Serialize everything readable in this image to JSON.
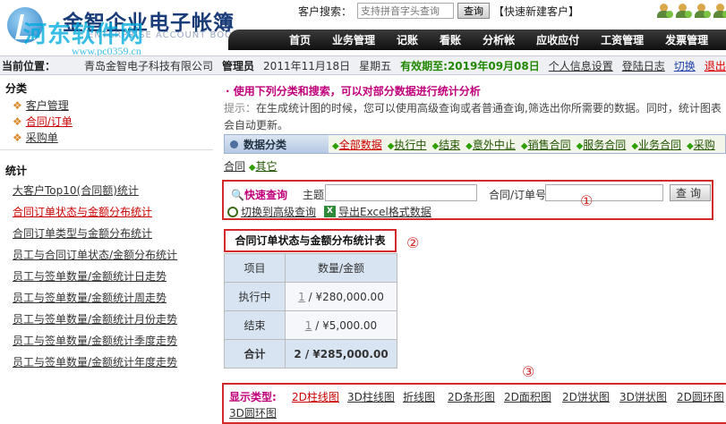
{
  "header": {
    "logo_title": "金智企业电子帐簿",
    "logo_sub": "ENTERPRISE ACCOUNT BOOK",
    "watermark": "河东软件网",
    "watermark_url": "www.pc0359.cn",
    "search_label": "客户搜索：",
    "search_placeholder": "支持拼音字头查询",
    "search_button": "查询",
    "new_customer": "【快速新建客户】"
  },
  "nav": {
    "items": [
      "首页",
      "业务管理",
      "记账",
      "看账",
      "分析帐",
      "应收应付",
      "工资管理",
      "发票管理"
    ]
  },
  "infobar": {
    "location_label": "当前位置：",
    "company": "青岛金智电子科技有限公司",
    "role": "管理员",
    "date": "2011年11月18日",
    "weekday": "星期五",
    "valid": "有效期至:2019年09月08日",
    "links": [
      "个人信息设置",
      "登陆日志",
      "切换",
      "退出"
    ]
  },
  "sidebar": {
    "cat_title": "分类",
    "cat_items": [
      "客户管理",
      "合同/订单",
      "采购单"
    ],
    "stat_title": "统计",
    "stat_items": [
      "大客户Top10(合同额)统计",
      "合同订单状态与金额分布统计",
      "合同订单类型与金额分布统计",
      "员工与合同订单状态/金额分布统计",
      "员工与签单数量/金额统计日走势",
      "员工与签单数量/金额统计周走势",
      "员工与签单数量/金额统计月份走势",
      "员工与签单数量/金额统计季度走势",
      "员工与签单数量/金额统计年度走势"
    ]
  },
  "main": {
    "hint_title": "· 使用下列分类和搜索，可以对部分数据进行统计分析",
    "hint_label": "提示：",
    "hint_text": "在生成统计图的时候，您可以使用高级查询或者普通查询,筛选出你所需要的数据。同时，统计图表会自动更新。",
    "cat_label": "数据分类",
    "cat_links": [
      "全部数据",
      "执行中",
      "结束",
      "意外中止",
      "销售合同",
      "服务合同",
      "业务合同",
      "采购"
    ],
    "cat_row2_prefix": "合同",
    "cat_row2_link": "其它",
    "quick_label": "快速查询",
    "subject_label": "主题",
    "order_label": "合同/订单号",
    "query_button": "查询",
    "adv_link": "切换到高级查询",
    "excel_link": "导出Excel格式数据",
    "circle1": "①",
    "circle2": "②",
    "circle3": "③",
    "table_title": "合同订单状态与金额分布统计表",
    "table": {
      "headers": [
        "项目",
        "数量/金额"
      ],
      "rows": [
        {
          "label": "执行中",
          "count": "1",
          "amount": " / ¥280,000.00"
        },
        {
          "label": "结束",
          "count": "1",
          "amount": " / ¥5,000.00"
        }
      ],
      "total": {
        "label": "合计",
        "value": "2 / ¥285,000.00"
      }
    },
    "display_label": "显示类型:",
    "display_items": [
      "2D柱线图",
      "3D柱线图",
      "折线图",
      "2D条形图",
      "2D面积图",
      "2D饼状图",
      "3D饼状图",
      "2D圆环图",
      "3D圆环图"
    ]
  },
  "colors": {
    "accent": "#c0007a",
    "frame": "#d32a2a",
    "nav_bg": "#1a1a1a"
  }
}
